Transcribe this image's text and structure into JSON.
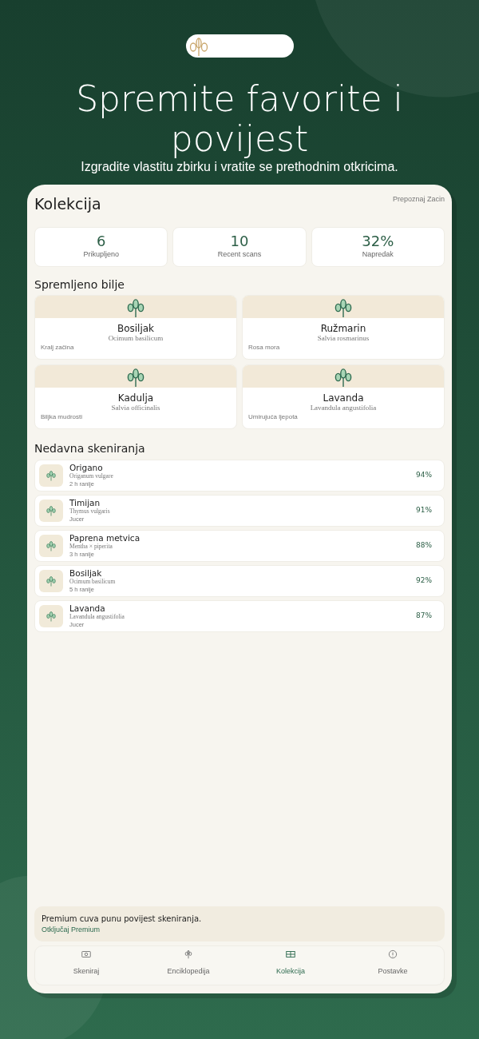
{
  "hero": {
    "title": "Spremite favorite i povijest",
    "subtitle": "Izgradite vlastitu zbirku i vratite se prethodnim otkricima."
  },
  "screen": {
    "title": "Kolekcija",
    "action": "Prepoznaj Zacin"
  },
  "stats": [
    {
      "value": "6",
      "label": "Prikupljeno"
    },
    {
      "value": "10",
      "label": "Recent scans"
    },
    {
      "value": "32%",
      "label": "Napredak"
    }
  ],
  "saved_section": "Spremljeno bilje",
  "saved": [
    {
      "name": "Bosiljak",
      "latin": "Ocimum basilicum",
      "note": "Kralj začina"
    },
    {
      "name": "Ružmarin",
      "latin": "Salvia rosmarinus",
      "note": "Rosa mora"
    },
    {
      "name": "Kadulja",
      "latin": "Salvia officinalis",
      "note": "Biljka mudrosti"
    },
    {
      "name": "Lavanda",
      "latin": "Lavandula angustifolia",
      "note": "Umirujuća ljepota"
    }
  ],
  "recent_section": "Nedavna skeniranja",
  "recent": [
    {
      "name": "Origano",
      "latin": "Origanum vulgare",
      "time": "2 h ranije",
      "score": "94%"
    },
    {
      "name": "Timijan",
      "latin": "Thymus vulgaris",
      "time": "Jucer",
      "score": "91%"
    },
    {
      "name": "Paprena metvica",
      "latin": "Mentha × piperita",
      "time": "3 h ranije",
      "score": "88%"
    },
    {
      "name": "Bosiljak",
      "latin": "Ocimum basilicum",
      "time": "5 h ranije",
      "score": "92%"
    },
    {
      "name": "Lavanda",
      "latin": "Lavandula angustifolia",
      "time": "Jucer",
      "score": "87%"
    }
  ],
  "premium": {
    "text": "Premium cuva punu povijest skeniranja.",
    "link": "Otključaj Premium"
  },
  "tabs": [
    {
      "kind": "camera",
      "label": "Skeniraj",
      "selected": false
    },
    {
      "kind": "plant",
      "label": "Enciklopedija",
      "selected": false
    },
    {
      "kind": "grid",
      "label": "Kolekcija",
      "selected": true
    },
    {
      "kind": "info",
      "label": "Postavke",
      "selected": false
    }
  ]
}
